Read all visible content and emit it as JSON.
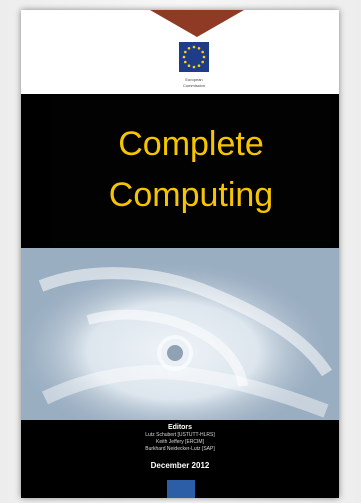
{
  "logo": {
    "line1": "European",
    "line2": "Commission"
  },
  "cover": {
    "title_line1": "Complete",
    "title_line2": "Computing",
    "editors_heading": "Editors",
    "editors": [
      "Lutz Schubert [USTUTT-HLRS]",
      "Keith Jeffery [ERCIM]",
      "Burkhard Neidecker-Lutz [SAP]"
    ],
    "date": "December 2012"
  },
  "colors": {
    "title": "#f7c500",
    "arrow": "#8e3a25",
    "flag": "#1f3c88"
  }
}
